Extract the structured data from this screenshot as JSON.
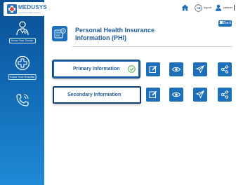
{
  "brand": {
    "name": "MEDUSYS",
    "tagline": "a perfect health solution"
  },
  "sidebar": {
    "items": [
      {
        "label": "Know Your Doctor",
        "icon": "doctor-icon"
      },
      {
        "label": "Know Your Hospital",
        "icon": "hospital-plus-icon"
      },
      {
        "label": "",
        "icon": "phone-call-icon"
      }
    ]
  },
  "topbar": {
    "logout_label": "logout",
    "user_label": "cabinet"
  },
  "back_label": "Back",
  "page": {
    "title": "Personal Health Insurance Information (PHI)"
  },
  "rows": [
    {
      "label": "Primary Information",
      "completed": true
    },
    {
      "label": "Secondary Information",
      "completed": false
    }
  ],
  "actions": [
    "edit-icon",
    "view-icon",
    "send-icon",
    "share-icon"
  ],
  "colors": {
    "primary": "#1c6fb8",
    "sidebar_top": "#0a4f93",
    "sidebar_bottom": "#1f8ad6",
    "success": "#4caf50"
  }
}
